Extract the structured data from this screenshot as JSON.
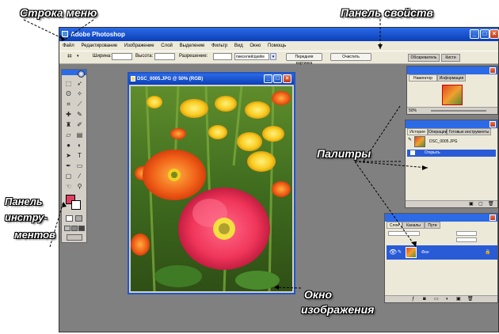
{
  "annotations": {
    "menu_bar": "Строка меню",
    "properties_panel": "Панель свойств",
    "palettes": "Палитры",
    "toolbox_line1": "Панель",
    "toolbox_line2": "инстру-",
    "toolbox_line3": "ментов",
    "image_window_line1": "Окно",
    "image_window_line2": "изображения"
  },
  "window": {
    "title": "Adobe Photoshop"
  },
  "menu": [
    "Файл",
    "Редактирование",
    "Изображение",
    "Слой",
    "Выделение",
    "Фильтр",
    "Вид",
    "Окно",
    "Помощь"
  ],
  "options": {
    "width_label": "Ширина:",
    "height_label": "Высота:",
    "resolution_label": "Разрешение:",
    "units": "пикселей/дюйм",
    "front_image_button": "Передняя картинка",
    "clear_button": "Очистить",
    "workspace_tabs": [
      "Обозреватель",
      "Кисти"
    ]
  },
  "image_window": {
    "title": "DSC_0005.JPG @ 50% (RGB)"
  },
  "navigator": {
    "tabs": [
      "Навигатор",
      "Информация"
    ],
    "zoom": "50%"
  },
  "history": {
    "tabs": [
      "История",
      "Операции",
      "Готовые инструменты"
    ],
    "snapshot": "DSC_0005.JPG",
    "step": "Открыть"
  },
  "layers": {
    "tabs": [
      "Слои",
      "Каналы",
      "Пути"
    ],
    "layer_name": "Фон"
  },
  "colors": {
    "xp_blue": "#1f55c8",
    "title_gradient_top": "#2c6ae6",
    "workspace_gray": "#808080",
    "palette_bg": "#ece9d8",
    "selection_blue": "#2a5bd7"
  }
}
